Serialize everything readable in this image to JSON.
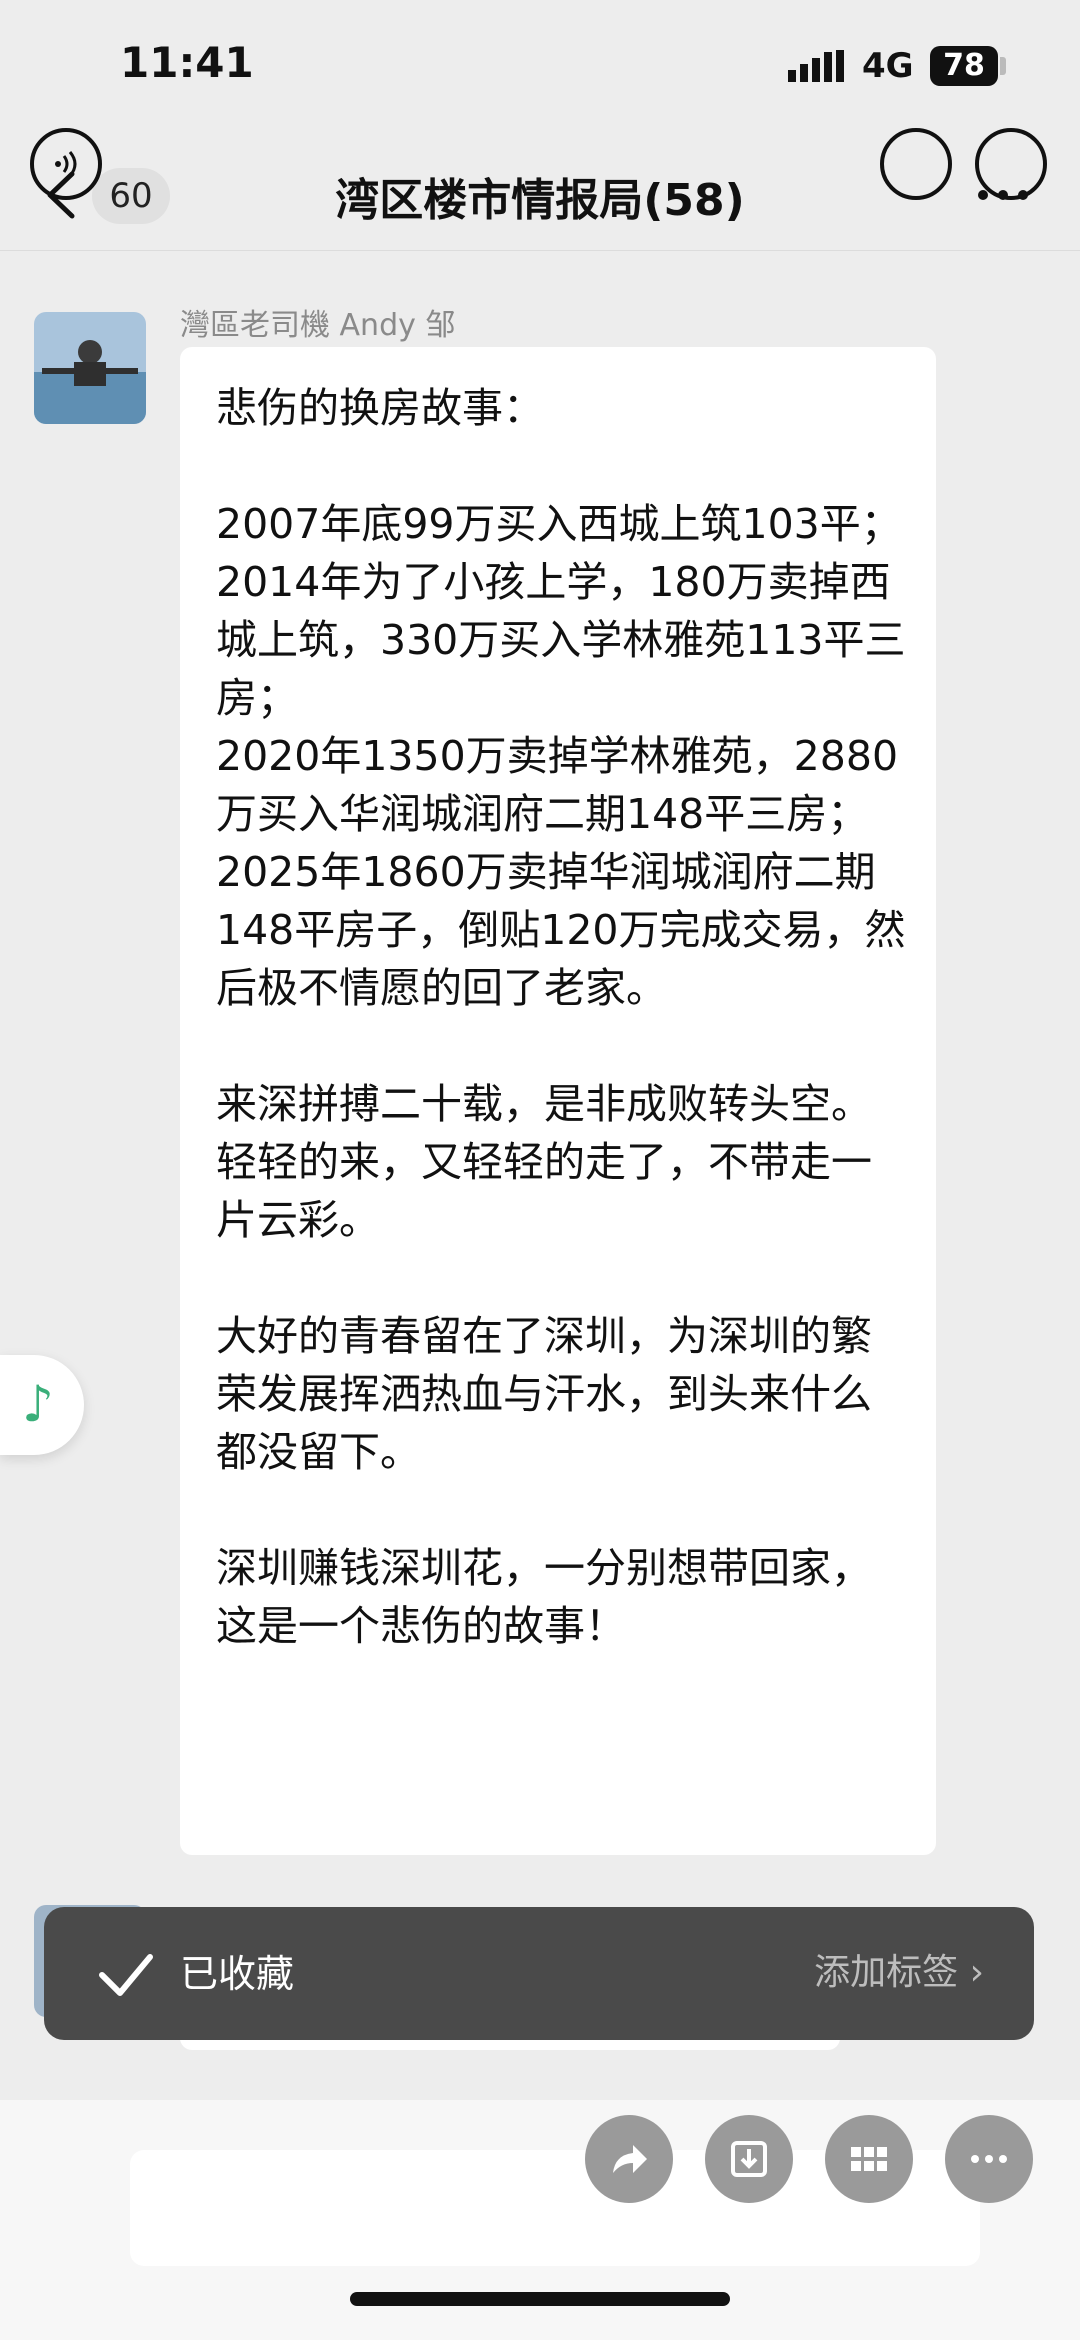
{
  "status_bar": {
    "time": "11:41",
    "network": "4G",
    "battery": "78"
  },
  "nav": {
    "unread_count": "60",
    "title": "湾区楼市情报局(58)"
  },
  "message": {
    "sender": "灣區老司機 Andy 邹",
    "paragraphs": [
      "悲伤的换房故事：",
      "2007年底99万买入西城上筑103平；\n2014年为了小孩上学，180万卖掉西城上筑，330万买入学林雅苑113平三房；\n2020年1350万卖掉学林雅苑，2880万买入华润城润府二期148平三房；\n2025年1860万卖掉华润城润府二期148平房子，倒贴120万完成交易，然后极不情愿的回了老家。",
      "来深拼搏二十载，是非成败转头空。轻轻的来，又轻轻的走了，不带走一片云彩。",
      "大好的青春留在了深圳，为深圳的繁荣发展挥洒热血与汗水，到头来什么都没留下。",
      "深圳赚钱深圳花，一分别想带回家，这是一个悲伤的故事！"
    ]
  },
  "toast": {
    "label": "已收藏",
    "action": "添加标签"
  },
  "icons": {
    "music": "music-note-icon",
    "accent_green": "#3aaf7a"
  }
}
